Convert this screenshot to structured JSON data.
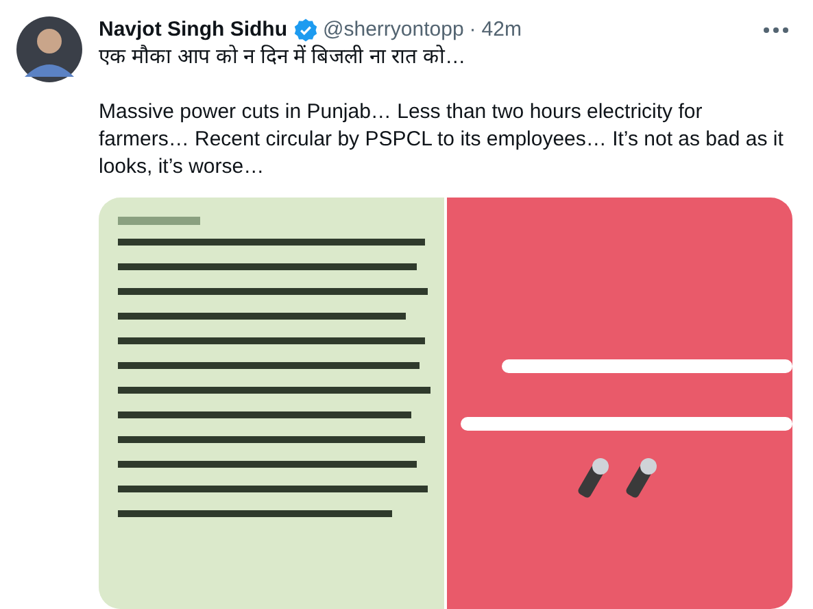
{
  "tweet": {
    "author": {
      "name": "Navjot Singh Sidhu",
      "verified": true,
      "handle": "@sherryontopp",
      "separator": "·",
      "time": "42m"
    },
    "paragraphs": [
      "एक मौका आप को न दिन में बिजली ना रात को…",
      "Massive power cuts in Punjab… Less than two hours electricity for farmers… Recent circular by PSPCL to its employees… It’s not as bad as it looks, it’s worse…"
    ]
  }
}
